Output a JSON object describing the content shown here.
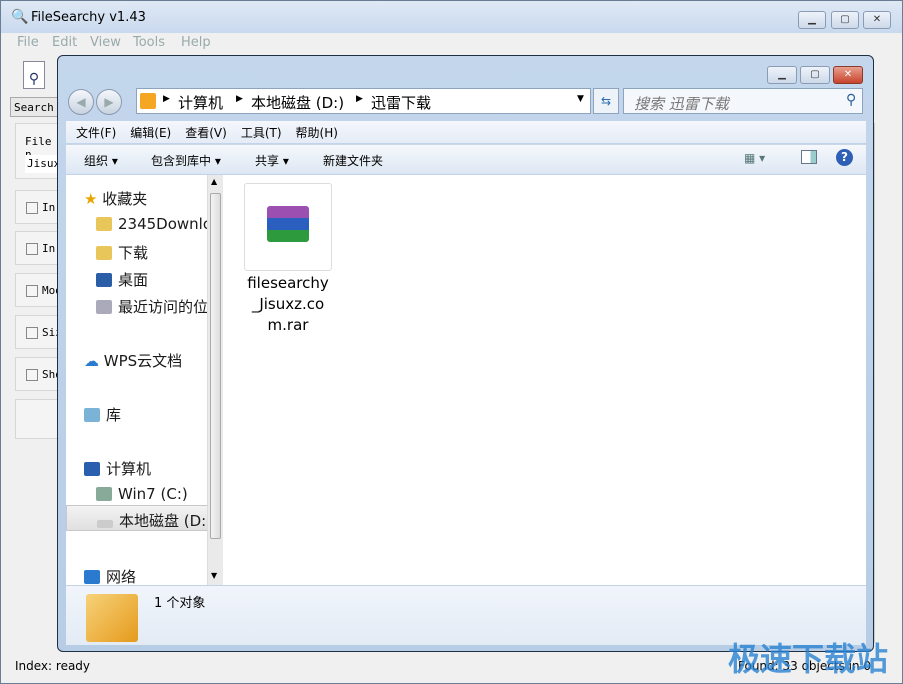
{
  "filesearchy": {
    "title": "FileSearchy v1.43",
    "menu": [
      "File",
      "Edit",
      "View",
      "Tools",
      "Help"
    ],
    "search_tab": "Search",
    "file_label": "File n",
    "file_value": "Jisux",
    "checkbox_labels": [
      "In",
      "In",
      "Mod",
      "Siz",
      "Sho"
    ],
    "status_left": "Index: ready",
    "status_right": "Found: 33 objects in 0"
  },
  "explorer": {
    "breadcrumb": [
      "计算机",
      "本地磁盘 (D:)",
      "迅雷下载"
    ],
    "search_placeholder": "搜索 迅雷下载",
    "menu": [
      "文件(F)",
      "编辑(E)",
      "查看(V)",
      "工具(T)",
      "帮助(H)"
    ],
    "toolbar": {
      "organize": "组织",
      "include": "包含到库中",
      "share": "共享",
      "new_folder": "新建文件夹"
    },
    "nav": {
      "favorites": "收藏夹",
      "fav_items": [
        "2345Downlo",
        "下载",
        "桌面",
        "最近访问的位"
      ],
      "wps": "WPS云文档",
      "library": "库",
      "computer": "计算机",
      "drives": [
        "Win7 (C:)",
        "本地磁盘 (D:"
      ],
      "network": "网络"
    },
    "file": {
      "name": "filesearchy_Jisuxz.com.rar",
      "line1": "filesearchy",
      "line2": "_Jisuxz.co",
      "line3": "m.rar"
    },
    "details": "1 个对象"
  },
  "watermark": "极速下载站"
}
